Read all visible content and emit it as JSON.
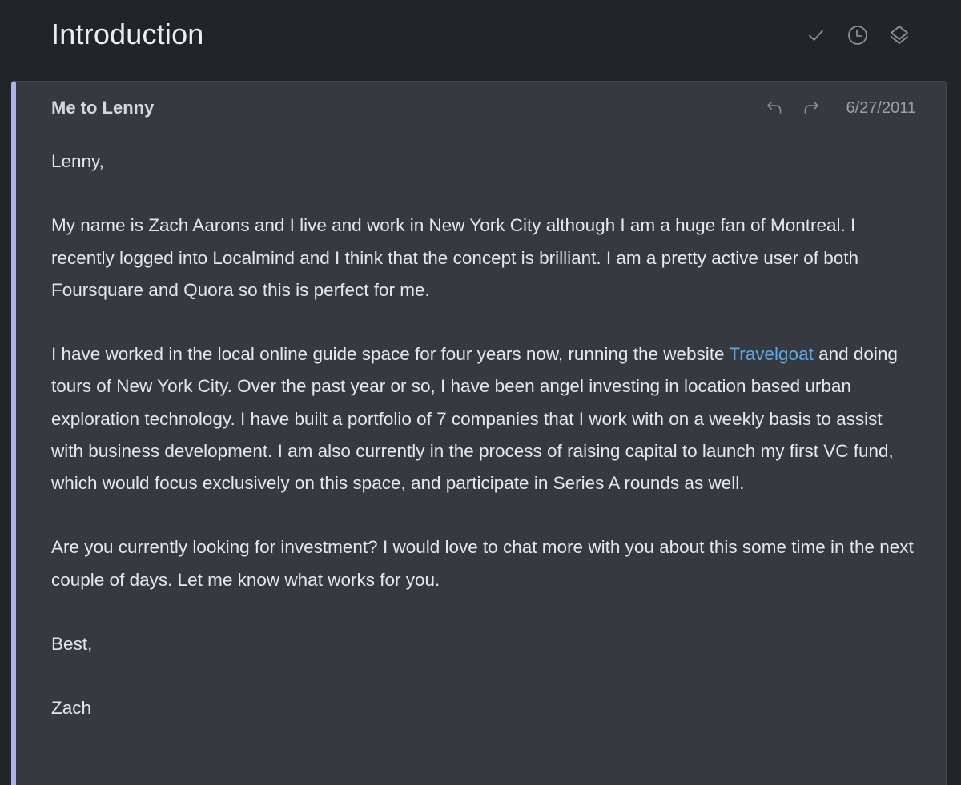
{
  "thread": {
    "subject": "Introduction",
    "actions": [
      {
        "icon": "check-icon",
        "label": "Done"
      },
      {
        "icon": "clock-icon",
        "label": "Remind me"
      },
      {
        "icon": "layers-icon",
        "label": "Move"
      }
    ]
  },
  "message": {
    "sender_line": "Me to Lenny",
    "date": "6/27/2011",
    "accent_color": "#aab4e8",
    "link_color": "#5aa9e6",
    "body": {
      "greeting": "Lenny,",
      "p1": "My name is Zach Aarons and I live and work in New York City although I am a huge fan of Montreal.  I recently logged into Localmind and I think that the concept is brilliant.  I am a pretty active user of both Foursquare and Quora so this is perfect for me.",
      "p2_before": "I have worked in the local online guide space for four years now, running the website ",
      "p2_link": "Travelgoat",
      "p2_after": " and doing tours of New York City.  Over the past year or so, I have been angel investing in location based urban exploration technology.  I have built a portfolio of 7 companies that I work with on a weekly basis to assist with business development.  I am also currently in the process of raising capital to launch my first VC fund, which would focus exclusively on this space, and participate in Series A rounds as well.",
      "p3": "Are you currently looking for investment?  I would love to chat more with you about this some time in the next couple of days.  Let me know what works for you.",
      "closing": "Best,",
      "signature": "Zach"
    }
  }
}
